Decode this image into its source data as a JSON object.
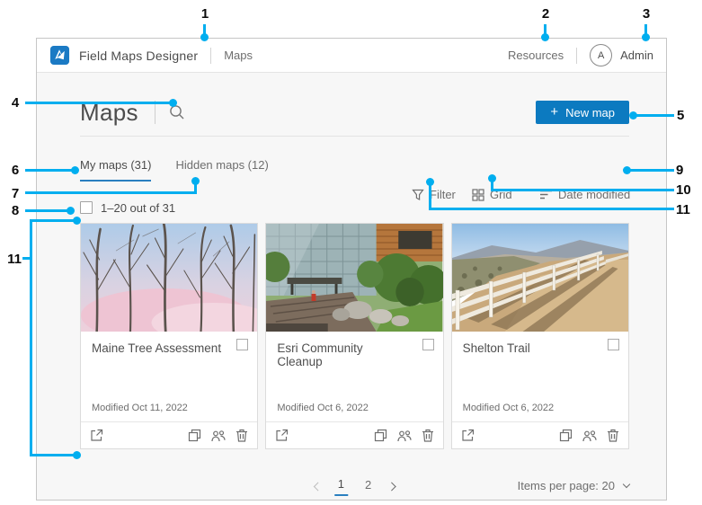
{
  "header": {
    "app_title": "Field Maps Designer",
    "nav_maps": "Maps",
    "resources": "Resources",
    "avatar_letter": "A",
    "username": "Admin"
  },
  "toolbar": {
    "page_title": "Maps",
    "new_map_plus": "+",
    "new_map_label": "New map"
  },
  "tabs": {
    "my_maps": "My maps (31)",
    "hidden_maps": "Hidden maps (12)"
  },
  "list_controls": {
    "filter": "Filter",
    "grid": "Grid",
    "sort": "Date modified"
  },
  "selection": {
    "range_label": "1–20 out of 31"
  },
  "cards": [
    {
      "title": "Maine Tree Assessment",
      "modified": "Modified Oct 11, 2022"
    },
    {
      "title": "Esri Community Cleanup",
      "modified": "Modified Oct 6, 2022"
    },
    {
      "title": "Shelton Trail",
      "modified": "Modified Oct 6, 2022"
    }
  ],
  "pagination": {
    "page_1": "1",
    "page_2": "2",
    "items_per_page": "Items per page: 20"
  },
  "callouts": {
    "c1": "1",
    "c2": "2",
    "c3": "3",
    "c4": "4",
    "c5": "5",
    "c6": "6",
    "c7": "7",
    "c8": "8",
    "c9": "9",
    "c10": "10",
    "c11_left": "11",
    "c11_right": "11"
  },
  "colors": {
    "accent_blue": "#0c7ac0",
    "callout_blue": "#00aeef"
  }
}
